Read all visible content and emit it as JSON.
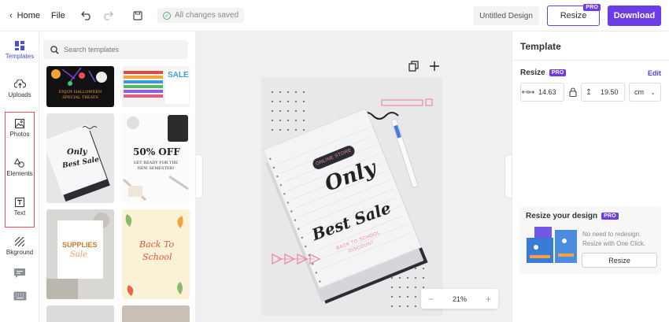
{
  "topbar": {
    "home_label": "Home",
    "file_label": "File",
    "save_status": "All changes saved",
    "design_name": "Untitled Design",
    "resize_label": "Resize",
    "pro_badge": "PRO",
    "download_label": "Download"
  },
  "rail": {
    "items": [
      {
        "label": "Templates"
      },
      {
        "label": "Uploads"
      },
      {
        "label": "Photos"
      },
      {
        "label": "Elements"
      },
      {
        "label": "Text"
      },
      {
        "label": "Bkground"
      }
    ]
  },
  "panel": {
    "search_placeholder": "Search templates",
    "thumbs": {
      "t1": "ENJOY HALLOWEEN SPECIAL TREATS",
      "t2": "SALE",
      "t3a": "Only",
      "t3b": "Best Sale",
      "t4a": "50% OFF",
      "t4b": "GET READY FOR THE NEW SEMESTER!",
      "t5a": "SUPPLIES",
      "t5b": "Sale",
      "t6a": "Back To",
      "t6b": "School"
    }
  },
  "canvas": {
    "badge": "ONLINE STORE",
    "line1": "Only",
    "line2": "Best Sale",
    "sub1": "BACK TO SCHOOL",
    "sub2": "DISCOUNT",
    "zoom_minus": "−",
    "zoom_value": "21%",
    "zoom_plus": "+"
  },
  "right_panel": {
    "title": "Template",
    "resize_label": "Resize",
    "pro_badge": "PRO",
    "edit_label": "Edit",
    "width_value": "14.63",
    "height_value": "19.50",
    "unit": "cm"
  },
  "promo": {
    "title": "Resize your design",
    "pro_badge": "PRO",
    "text": "No need to redesign. Resize with One Click.",
    "button": "Resize"
  },
  "colors": {
    "accent": "#6b3ce8",
    "rail_highlight_border": "#e25353",
    "canvas_bg": "#f0f0f0",
    "page_bg": "#e8e8ea",
    "notebook": "#f4f4f6",
    "dark_notebook": "#2b2d33",
    "pink": "#e98aa7"
  }
}
